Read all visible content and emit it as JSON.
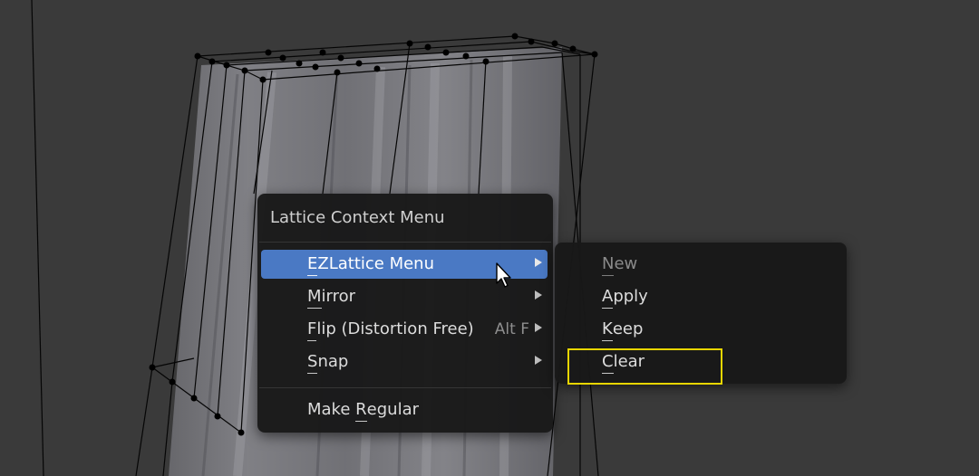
{
  "context_menu": {
    "title": "Lattice Context Menu",
    "items": [
      {
        "label_u": "E",
        "label_rest": "ZLattice Menu",
        "shortcut": "",
        "submenu": true,
        "active": true
      },
      {
        "label_u": "M",
        "label_rest": "irror",
        "shortcut": "",
        "submenu": true,
        "active": false
      },
      {
        "label_u": "F",
        "label_rest": "lip (Distortion Free)",
        "shortcut": "Alt F",
        "submenu": true,
        "active": false
      },
      {
        "label_u": "S",
        "label_rest": "nap",
        "shortcut": "",
        "submenu": true,
        "active": false
      },
      {
        "label_pre": "Make ",
        "label_u": "R",
        "label_rest": "egular",
        "shortcut": "",
        "submenu": false,
        "active": false
      }
    ]
  },
  "submenu": {
    "items": [
      {
        "label_u": "N",
        "label_rest": "ew",
        "enabled": false
      },
      {
        "label_u": "A",
        "label_rest": "pply",
        "enabled": true
      },
      {
        "label_u": "K",
        "label_rest": "eep",
        "enabled": true
      },
      {
        "label_u": "C",
        "label_rest": "lear",
        "enabled": true
      }
    ]
  },
  "colors": {
    "viewport_bg": "#3a3a3a",
    "menu_bg": "#181818",
    "active_item": "#4a79c4",
    "highlight_box": "#e8d600"
  }
}
